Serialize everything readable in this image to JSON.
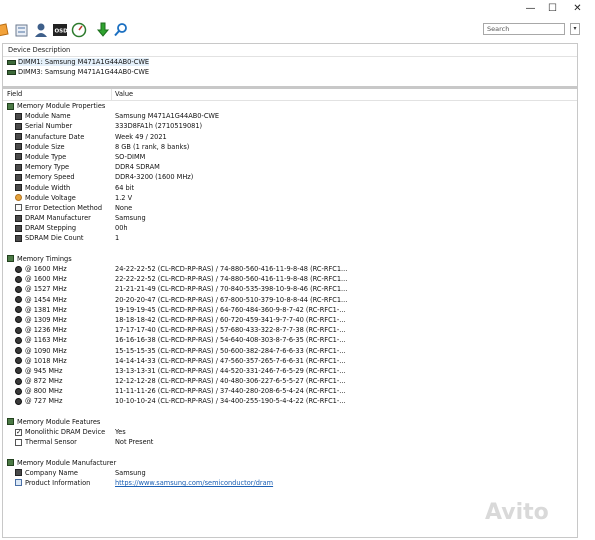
{
  "window": {
    "minimize": "—",
    "maximize": "☐",
    "close": "✕"
  },
  "toolbar": {
    "search_placeholder": "Search",
    "search_dropdown": "▾"
  },
  "devices": {
    "header": "Device Description",
    "items": [
      {
        "label": "DIMM1: Samsung M471A1G44AB0-CWE"
      },
      {
        "label": "DIMM3: Samsung M471A1G44AB0-CWE"
      }
    ]
  },
  "table": {
    "col_field": "Field",
    "col_value": "Value",
    "groups": {
      "properties": "Memory Module Properties",
      "timings": "Memory Timings",
      "features": "Memory Module Features",
      "manufacturer": "Memory Module Manufacturer"
    },
    "properties": [
      {
        "field": "Module Name",
        "value": "Samsung M471A1G44AB0-CWE",
        "icon": "chip"
      },
      {
        "field": "Serial Number",
        "value": "333D8FA1h (2710519081)",
        "icon": "chip"
      },
      {
        "field": "Manufacture Date",
        "value": "Week 49 / 2021",
        "icon": "chip"
      },
      {
        "field": "Module Size",
        "value": "8 GB (1 rank, 8 banks)",
        "icon": "chip"
      },
      {
        "field": "Module Type",
        "value": "SO-DIMM",
        "icon": "chip"
      },
      {
        "field": "Memory Type",
        "value": "DDR4 SDRAM",
        "icon": "chip"
      },
      {
        "field": "Memory Speed",
        "value": "DDR4-3200 (1600 MHz)",
        "icon": "chip"
      },
      {
        "field": "Module Width",
        "value": "64 bit",
        "icon": "chip"
      },
      {
        "field": "Module Voltage",
        "value": "1.2 V",
        "icon": "volt"
      },
      {
        "field": "Error Detection Method",
        "value": "None",
        "icon": "page"
      },
      {
        "field": "DRAM Manufacturer",
        "value": "Samsung",
        "icon": "chip"
      },
      {
        "field": "DRAM Stepping",
        "value": "00h",
        "icon": "chip"
      },
      {
        "field": "SDRAM Die Count",
        "value": "1",
        "icon": "chip"
      }
    ],
    "timings": [
      {
        "field": "@ 1600 MHz",
        "value": "24-22-22-52  (CL-RCD-RP-RAS) / 74-880-560-416-11-9-8-48  (RC-RFC1..."
      },
      {
        "field": "@ 1600 MHz",
        "value": "22-22-22-52  (CL-RCD-RP-RAS) / 74-880-560-416-11-9-8-48  (RC-RFC1..."
      },
      {
        "field": "@ 1527 MHz",
        "value": "21-21-21-49  (CL-RCD-RP-RAS) / 70-840-535-398-10-9-8-46  (RC-RFC1..."
      },
      {
        "field": "@ 1454 MHz",
        "value": "20-20-20-47  (CL-RCD-RP-RAS) / 67-800-510-379-10-8-8-44  (RC-RFC1..."
      },
      {
        "field": "@ 1381 MHz",
        "value": "19-19-19-45  (CL-RCD-RP-RAS) / 64-760-484-360-9-8-7-42  (RC-RFC1-..."
      },
      {
        "field": "@ 1309 MHz",
        "value": "18-18-18-42  (CL-RCD-RP-RAS) / 60-720-459-341-9-7-7-40  (RC-RFC1-..."
      },
      {
        "field": "@ 1236 MHz",
        "value": "17-17-17-40  (CL-RCD-RP-RAS) / 57-680-433-322-8-7-7-38  (RC-RFC1-..."
      },
      {
        "field": "@ 1163 MHz",
        "value": "16-16-16-38  (CL-RCD-RP-RAS) / 54-640-408-303-8-7-6-35  (RC-RFC1-..."
      },
      {
        "field": "@ 1090 MHz",
        "value": "15-15-15-35  (CL-RCD-RP-RAS) / 50-600-382-284-7-6-6-33  (RC-RFC1-..."
      },
      {
        "field": "@ 1018 MHz",
        "value": "14-14-14-33  (CL-RCD-RP-RAS) / 47-560-357-265-7-6-6-31  (RC-RFC1-..."
      },
      {
        "field": "@ 945 MHz",
        "value": "13-13-13-31  (CL-RCD-RP-RAS) / 44-520-331-246-7-6-5-29  (RC-RFC1-..."
      },
      {
        "field": "@ 872 MHz",
        "value": "12-12-12-28  (CL-RCD-RP-RAS) / 40-480-306-227-6-5-5-27  (RC-RFC1-..."
      },
      {
        "field": "@ 800 MHz",
        "value": "11-11-11-26  (CL-RCD-RP-RAS) / 37-440-280-208-6-5-4-24  (RC-RFC1-..."
      },
      {
        "field": "@ 727 MHz",
        "value": "10-10-10-24  (CL-RCD-RP-RAS) / 34-400-255-190-5-4-4-22  (RC-RFC1-..."
      }
    ],
    "features": [
      {
        "field": "Monolithic DRAM Device",
        "value": "Yes",
        "checked": true
      },
      {
        "field": "Thermal Sensor",
        "value": "Not Present",
        "checked": false
      }
    ],
    "manufacturer": [
      {
        "field": "Company Name",
        "value": "Samsung",
        "icon": "chip"
      },
      {
        "field": "Product Information",
        "value": "https://www.samsung.com/semiconductor/dram",
        "icon": "link"
      }
    ]
  },
  "watermark": "Avito"
}
